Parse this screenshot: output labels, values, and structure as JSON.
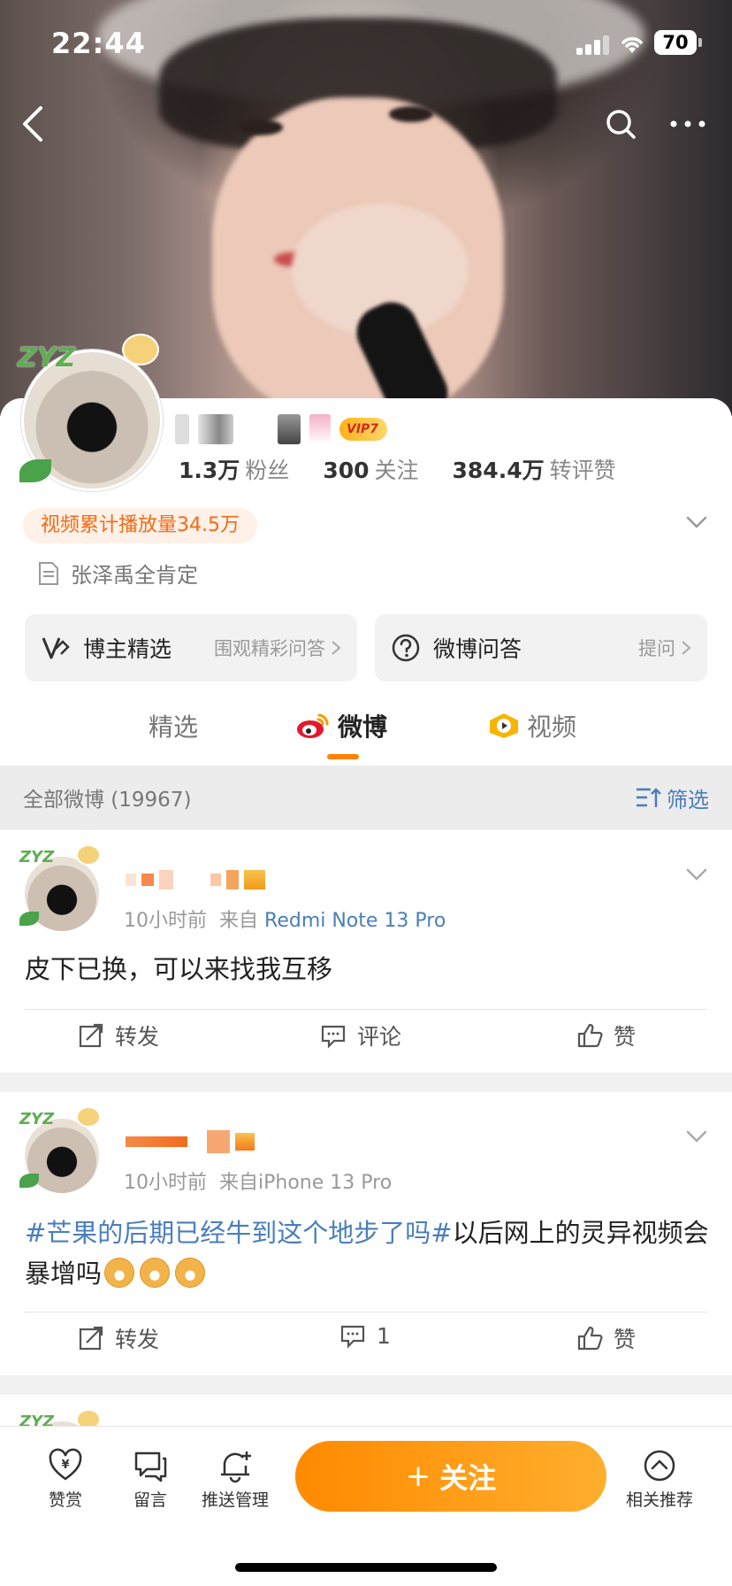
{
  "status_bar": {
    "time": "22:44",
    "battery": "70"
  },
  "profile": {
    "vip": "VIP7",
    "stats": [
      {
        "num": "1.3万",
        "label": "粉丝"
      },
      {
        "num": "300",
        "label": "关注"
      },
      {
        "num": "384.4万",
        "label": "转评赞"
      }
    ],
    "video_play": "视频累计播放量34.5万",
    "bio": "张泽禹全肯定"
  },
  "features": {
    "left": {
      "title": "博主精选",
      "sub": "围观精彩问答"
    },
    "right": {
      "title": "微博问答",
      "sub": "提问"
    }
  },
  "tabs": {
    "featured": "精选",
    "weibo": "微博",
    "video": "视频"
  },
  "filter_bar": {
    "count": "全部微博 (19967)",
    "filter": "筛选"
  },
  "posts": [
    {
      "time": "10小时前",
      "from": "来自",
      "device": "Redmi Note 13 Pro",
      "text": "皮下已换，可以来找我互移",
      "repost": "转发",
      "comment": "评论",
      "like": "赞"
    },
    {
      "time": "10小时前",
      "from": "来自",
      "device": "iPhone 13 Pro",
      "topic": "#芒果的后期已经牛到这个地步了吗#",
      "text": "以后网上的灵异视频会暴增吗",
      "repost": "转发",
      "comment": "1",
      "like": "赞"
    }
  ],
  "bottom_bar": {
    "reward": "赞赏",
    "message": "留言",
    "push": "推送管理",
    "follow": "关注",
    "related": "相关推荐"
  },
  "colors": {
    "accent": "#ff8200",
    "link": "#4a7ebb"
  }
}
